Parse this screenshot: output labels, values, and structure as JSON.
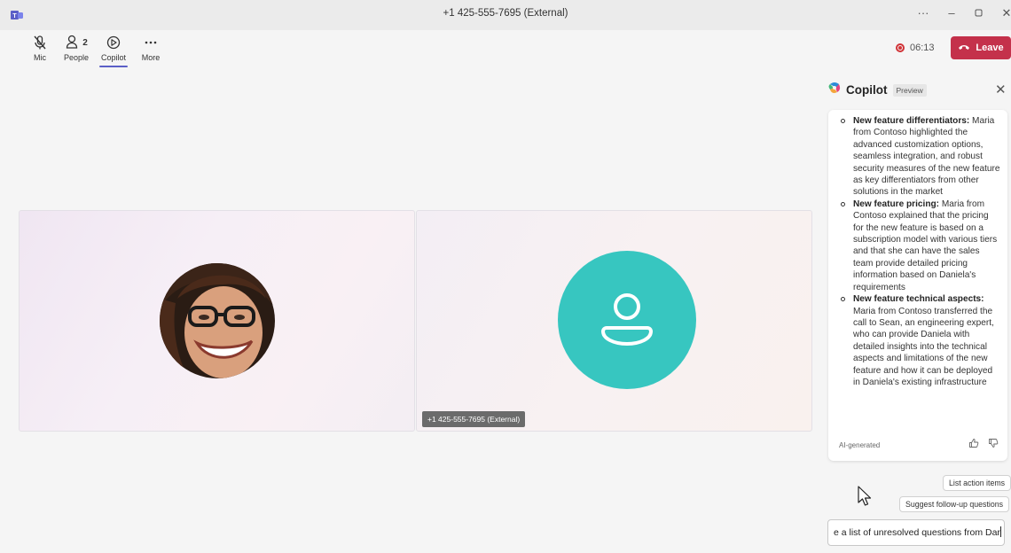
{
  "window": {
    "title": "+1 425-555-7695 (External)",
    "controls": [
      "more-options-icon",
      "minimize-icon",
      "restore-icon",
      "close-icon"
    ]
  },
  "toolbar": {
    "mic_label": "Mic",
    "people_label": "People",
    "people_count": "2",
    "copilot_label": "Copilot",
    "more_label": "More",
    "timer": "06:13",
    "leave_label": "Leave",
    "colors": {
      "leave": "#c4314b",
      "recording": "#d13438",
      "active_tab": "#5b5fc7"
    }
  },
  "stage": {
    "participant_left": {
      "type": "photo"
    },
    "participant_right": {
      "type": "generic-avatar",
      "name_tag": "+1 425-555-7695 (External)",
      "avatar_color": "#37c6c0"
    }
  },
  "copilot": {
    "title": "Copilot",
    "badge": "Preview",
    "items": [
      {
        "heading": "New feature differentiators:",
        "text": " Maria from Contoso highlighted the advanced customization options, seamless integration, and robust security measures of the new feature as key differentiators from other solutions in the market"
      },
      {
        "heading": "New feature pricing:",
        "text": " Maria from Contoso explained that the pricing for the new feature is based on a subscription model with various tiers and that she can have the sales team provide detailed pricing information based on Daniela's requirements"
      },
      {
        "heading": "New feature technical aspects:",
        "text": " Maria from Contoso transferred the call to Sean, an engineering expert, who can provide Daniela with detailed insights into the technical aspects and limitations of the new feature and how it can be deployed in Daniela's existing infrastructure"
      }
    ],
    "ai_label": "AI-generated",
    "suggestions": [
      "List action items",
      "Suggest follow-up questions"
    ],
    "input_value": "e a list of unresolved questions from Dar"
  }
}
